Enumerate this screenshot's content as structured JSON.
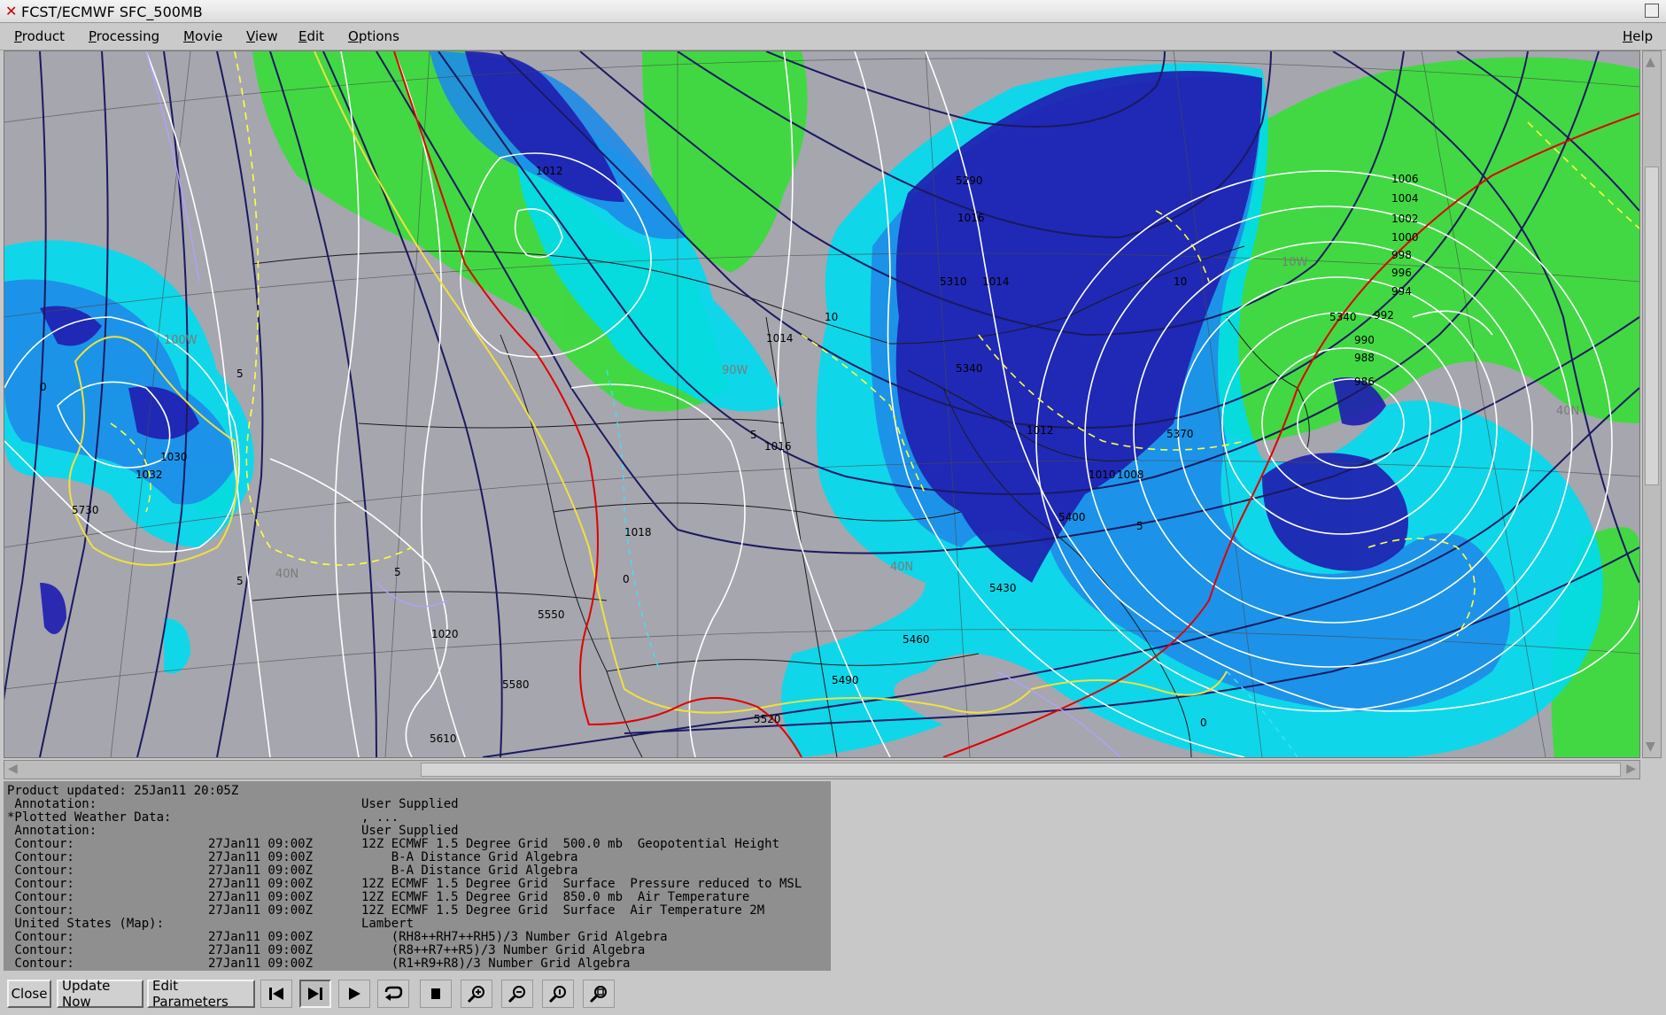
{
  "window": {
    "title": "FCST/ECMWF SFC_500MB"
  },
  "menubar": {
    "items": [
      "Product",
      "Processing",
      "Movie",
      "View",
      "Edit",
      "Options"
    ],
    "help": "Help"
  },
  "colors": {
    "map_background": "#a6a6ae",
    "precip_light": "#00e0f0",
    "precip_medium": "#1e8ce8",
    "precip_heavy": "#1a1aa8",
    "rh_green": "#30e030",
    "isobar": "#ffffff",
    "height_contour": "#1a1a60",
    "freeze_line": "#e00000",
    "temp_line": "#ffff20"
  },
  "map": {
    "pressure_labels": [
      "1012",
      "1016",
      "1014",
      "1014",
      "1016",
      "1018",
      "1020",
      "1012",
      "1010",
      "1008",
      "1030",
      "1032",
      "1006",
      "1004",
      "1002",
      "1000",
      "998",
      "996",
      "994",
      "992",
      "990",
      "988",
      "986"
    ],
    "height_labels": [
      "5290",
      "5310",
      "5340",
      "5370",
      "5400",
      "5430",
      "5460",
      "5490",
      "5520",
      "5550",
      "5580",
      "5610",
      "5730",
      "5340"
    ],
    "temp_labels": [
      "5",
      "5",
      "5",
      "5",
      "5",
      "10",
      "10",
      "0",
      "0",
      "0"
    ],
    "latlon_labels": [
      "40N",
      "40N",
      "40N",
      "100W",
      "90W",
      "10W"
    ]
  },
  "info": {
    "updated": "Product updated: 25Jan11 20:05Z",
    "rows": [
      {
        "label": " Annotation:",
        "time": "",
        "desc": "User Supplied"
      },
      {
        "label": "*Plotted Weather Data:",
        "time": "",
        "desc": ", ..."
      },
      {
        "label": " Annotation:",
        "time": "",
        "desc": "User Supplied"
      },
      {
        "label": " Contour:",
        "time": "27Jan11 09:00Z",
        "desc": "12Z ECMWF 1.5 Degree Grid  500.0 mb  Geopotential Height"
      },
      {
        "label": " Contour:",
        "time": "27Jan11 09:00Z",
        "desc": "    B-A Distance Grid Algebra"
      },
      {
        "label": " Contour:",
        "time": "27Jan11 09:00Z",
        "desc": "    B-A Distance Grid Algebra"
      },
      {
        "label": " Contour:",
        "time": "27Jan11 09:00Z",
        "desc": "12Z ECMWF 1.5 Degree Grid  Surface  Pressure reduced to MSL"
      },
      {
        "label": " Contour:",
        "time": "27Jan11 09:00Z",
        "desc": "12Z ECMWF 1.5 Degree Grid  850.0 mb  Air Temperature"
      },
      {
        "label": " Contour:",
        "time": "27Jan11 09:00Z",
        "desc": "12Z ECMWF 1.5 Degree Grid  Surface  Air Temperature 2M"
      },
      {
        "label": " United States (Map):",
        "time": "",
        "desc": "Lambert"
      },
      {
        "label": " Contour:",
        "time": "27Jan11 09:00Z",
        "desc": "    (RH8++RH7++RH5)/3 Number Grid Algebra"
      },
      {
        "label": " Contour:",
        "time": "27Jan11 09:00Z",
        "desc": "    (R8++R7++R5)/3 Number Grid Algebra"
      },
      {
        "label": " Contour:",
        "time": "27Jan11 09:00Z",
        "desc": "    (R1+R9+R8)/3 Number Grid Algebra"
      }
    ]
  },
  "toolbar": {
    "close": "Close",
    "update_now": "Update Now",
    "edit_parameters": "Edit Parameters",
    "icons": [
      "first-frame-icon",
      "last-frame-icon",
      "play-icon",
      "loop-icon",
      "stop-icon",
      "zoom-in-icon",
      "zoom-out-icon",
      "zoom-reset-icon",
      "zoom-fit-icon"
    ]
  }
}
